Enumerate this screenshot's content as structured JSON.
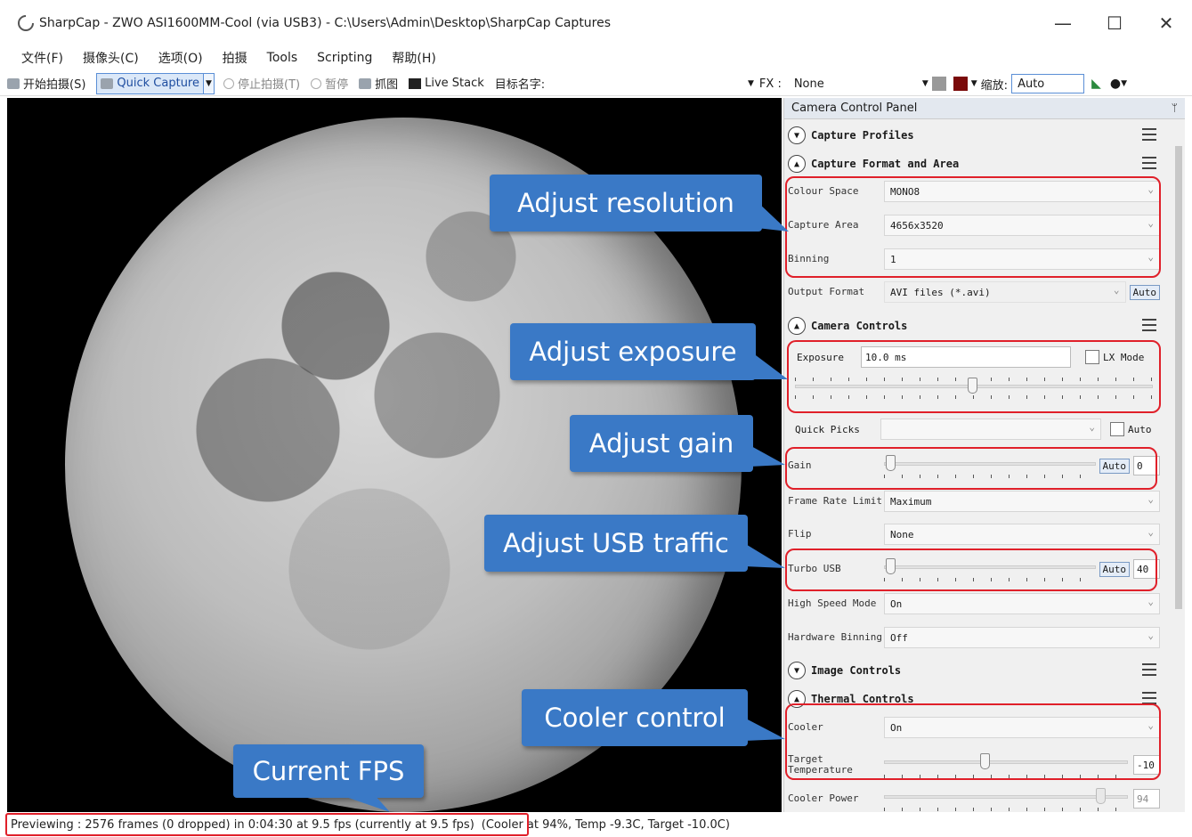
{
  "window": {
    "title": "SharpCap - ZWO ASI1600MM-Cool (via USB3) - C:\\Users\\Admin\\Desktop\\SharpCap Captures",
    "minimize": "—",
    "maximize": "☐",
    "close": "✕"
  },
  "menu": [
    "文件(F)",
    "摄像头(C)",
    "选项(O)",
    "拍摄",
    "Tools",
    "Scripting",
    "帮助(H)"
  ],
  "toolbar": {
    "start_capture": "开始拍摄(S)",
    "quick_capture": "Quick Capture",
    "stop_capture": "停止拍摄(T)",
    "pause": "暂停",
    "snapshot": "抓图",
    "live_stack": "Live Stack",
    "target_name": "目标名字:",
    "fx_label": "FX :",
    "fx_value": "None",
    "zoom_label": "缩放:",
    "zoom_value": "Auto"
  },
  "panel": {
    "title": "Camera Control Panel",
    "pin": "ᛘ",
    "sections": {
      "capture_profiles": "Capture Profiles",
      "capture_format": "Capture Format and Area",
      "camera_controls": "Camera Controls",
      "image_controls": "Image Controls",
      "thermal_controls": "Thermal Controls"
    },
    "format": {
      "colour_space_label": "Colour Space",
      "colour_space_value": "MONO8",
      "capture_area_label": "Capture Area",
      "capture_area_value": "4656x3520",
      "binning_label": "Binning",
      "binning_value": "1",
      "output_format_label": "Output Format",
      "output_format_value": "AVI files (*.avi)",
      "output_auto": "Auto"
    },
    "camera": {
      "exposure_label": "Exposure",
      "exposure_value": "10.0 ms",
      "lx_mode": "LX Mode",
      "quick_picks_label": "Quick Picks",
      "quick_picks_auto": "Auto",
      "gain_label": "Gain",
      "gain_auto": "Auto",
      "gain_value": "0",
      "frame_rate_label": "Frame Rate Limit",
      "frame_rate_value": "Maximum",
      "flip_label": "Flip",
      "flip_value": "None",
      "turbo_usb_label": "Turbo USB",
      "turbo_usb_auto": "Auto",
      "turbo_usb_value": "40",
      "high_speed_label": "High Speed Mode",
      "high_speed_value": "On",
      "hw_binning_label": "Hardware Binning",
      "hw_binning_value": "Off"
    },
    "thermal": {
      "cooler_label": "Cooler",
      "cooler_value": "On",
      "target_temp_label": "Target Temperature",
      "target_temp_value": "-10",
      "cooler_power_label": "Cooler Power",
      "cooler_power_value": "94"
    }
  },
  "callouts": {
    "resolution": "Adjust resolution",
    "exposure": "Adjust exposure",
    "gain": "Adjust gain",
    "usb": "Adjust USB traffic",
    "cooler": "Cooler control",
    "fps": "Current FPS"
  },
  "status": {
    "preview": "Previewing : 2576 frames (0 dropped) in 0:04:30 at 9.5 fps  (currently at 9.5 fps)",
    "cooler": "(Cooler at 94%, Temp -9.3C, Target -10.0C)"
  },
  "colors": {
    "accent_blue": "#3a79c6",
    "highlight_red": "#e0202a",
    "panel_bg": "#f0f0f0"
  }
}
